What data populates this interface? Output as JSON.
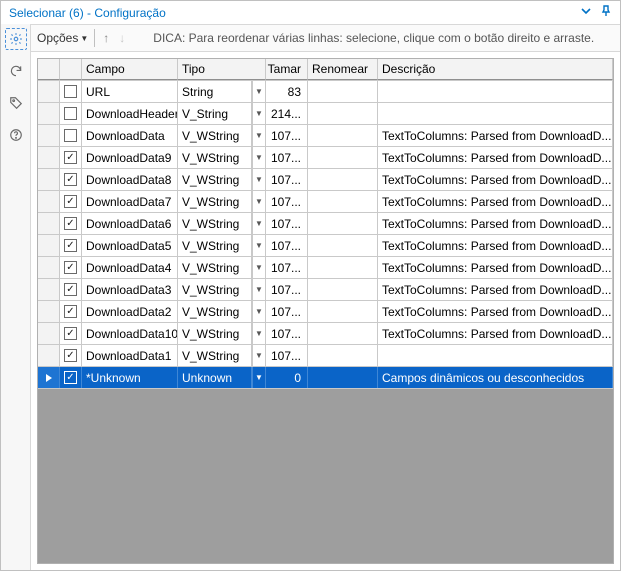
{
  "title": "Selecionar (6) - Configuração",
  "toolbar": {
    "opcoes_label": "Opções",
    "hint": "DICA: Para reordenar várias linhas: selecione, clique com o botão direito e arraste."
  },
  "headers": {
    "campo": "Campo",
    "tipo": "Tipo",
    "tamar": "Tamar",
    "renomear": "Renomear",
    "descricao": "Descrição"
  },
  "rows": [
    {
      "checked": false,
      "campo": "URL",
      "tipo": "String",
      "tamar": "83",
      "renomear": "",
      "desc": "",
      "selected": false
    },
    {
      "checked": false,
      "campo": "DownloadHeaders",
      "tipo": "V_String",
      "tamar": "214...",
      "renomear": "",
      "desc": "",
      "selected": false
    },
    {
      "checked": false,
      "campo": "DownloadData",
      "tipo": "V_WString",
      "tamar": "107...",
      "renomear": "",
      "desc": "TextToColumns: Parsed from DownloadD...",
      "selected": false
    },
    {
      "checked": true,
      "campo": "DownloadData9",
      "tipo": "V_WString",
      "tamar": "107...",
      "renomear": "",
      "desc": "TextToColumns: Parsed from DownloadD...",
      "selected": false
    },
    {
      "checked": true,
      "campo": "DownloadData8",
      "tipo": "V_WString",
      "tamar": "107...",
      "renomear": "",
      "desc": "TextToColumns: Parsed from DownloadD...",
      "selected": false
    },
    {
      "checked": true,
      "campo": "DownloadData7",
      "tipo": "V_WString",
      "tamar": "107...",
      "renomear": "",
      "desc": "TextToColumns: Parsed from DownloadD...",
      "selected": false
    },
    {
      "checked": true,
      "campo": "DownloadData6",
      "tipo": "V_WString",
      "tamar": "107...",
      "renomear": "",
      "desc": "TextToColumns: Parsed from DownloadD...",
      "selected": false
    },
    {
      "checked": true,
      "campo": "DownloadData5",
      "tipo": "V_WString",
      "tamar": "107...",
      "renomear": "",
      "desc": "TextToColumns: Parsed from DownloadD...",
      "selected": false
    },
    {
      "checked": true,
      "campo": "DownloadData4",
      "tipo": "V_WString",
      "tamar": "107...",
      "renomear": "",
      "desc": "TextToColumns: Parsed from DownloadD...",
      "selected": false
    },
    {
      "checked": true,
      "campo": "DownloadData3",
      "tipo": "V_WString",
      "tamar": "107...",
      "renomear": "",
      "desc": "TextToColumns: Parsed from DownloadD...",
      "selected": false
    },
    {
      "checked": true,
      "campo": "DownloadData2",
      "tipo": "V_WString",
      "tamar": "107...",
      "renomear": "",
      "desc": "TextToColumns: Parsed from DownloadD...",
      "selected": false
    },
    {
      "checked": true,
      "campo": "DownloadData10",
      "tipo": "V_WString",
      "tamar": "107...",
      "renomear": "",
      "desc": "TextToColumns: Parsed from DownloadD...",
      "selected": false
    },
    {
      "checked": true,
      "campo": "DownloadData1",
      "tipo": "V_WString",
      "tamar": "107...",
      "renomear": "",
      "desc": "",
      "selected": false
    },
    {
      "checked": true,
      "campo": "*Unknown",
      "tipo": "Unknown",
      "tamar": "0",
      "renomear": "",
      "desc": "Campos dinâmicos ou desconhecidos",
      "selected": true
    }
  ]
}
